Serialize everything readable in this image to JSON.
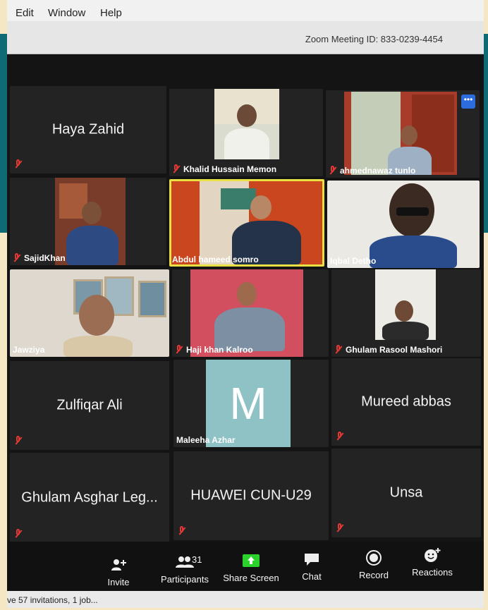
{
  "menu": {
    "items": [
      "Edit",
      "Window",
      "Help"
    ]
  },
  "meeting": {
    "id_text": "Zoom Meeting ID: 833-0239-4454"
  },
  "tiles": {
    "haya": {
      "name": "Haya Zahid"
    },
    "khalid": {
      "name": "Khalid Hussain Memon"
    },
    "ahmed": {
      "name": "ahmednawaz tunlo"
    },
    "sajid": {
      "name": "SajidKhan"
    },
    "abdul": {
      "name": "Abdul hameed somro"
    },
    "iqbal": {
      "name": "Iqbal Detho"
    },
    "jawziya": {
      "name": "Jawziya"
    },
    "haji": {
      "name": "Haji khan Kalroo"
    },
    "ghulam_rasool": {
      "name": "Ghulam Rasool Mashori"
    },
    "zulfiqar": {
      "name": "Zulfiqar Ali"
    },
    "maleeha": {
      "name": "Maleeha Azhar",
      "avatar_letter": "M"
    },
    "mureed": {
      "name": "Mureed abbas"
    },
    "ghulam_asghar": {
      "name": "Ghulam Asghar Leg..."
    },
    "huawei": {
      "name": "HUAWEI CUN-U29"
    },
    "unsa": {
      "name": "Unsa"
    }
  },
  "toolbar": {
    "invite": "Invite",
    "participants": "Participants",
    "participants_count": "31",
    "share_screen": "Share Screen",
    "chat": "Chat",
    "record": "Record",
    "reactions": "Reactions"
  },
  "status": {
    "text": "ve 57 invitations, 1 job..."
  },
  "colors": {
    "active_speaker": "#e8e045",
    "mute_red": "#e53935",
    "share_green": "#2bd22b"
  }
}
